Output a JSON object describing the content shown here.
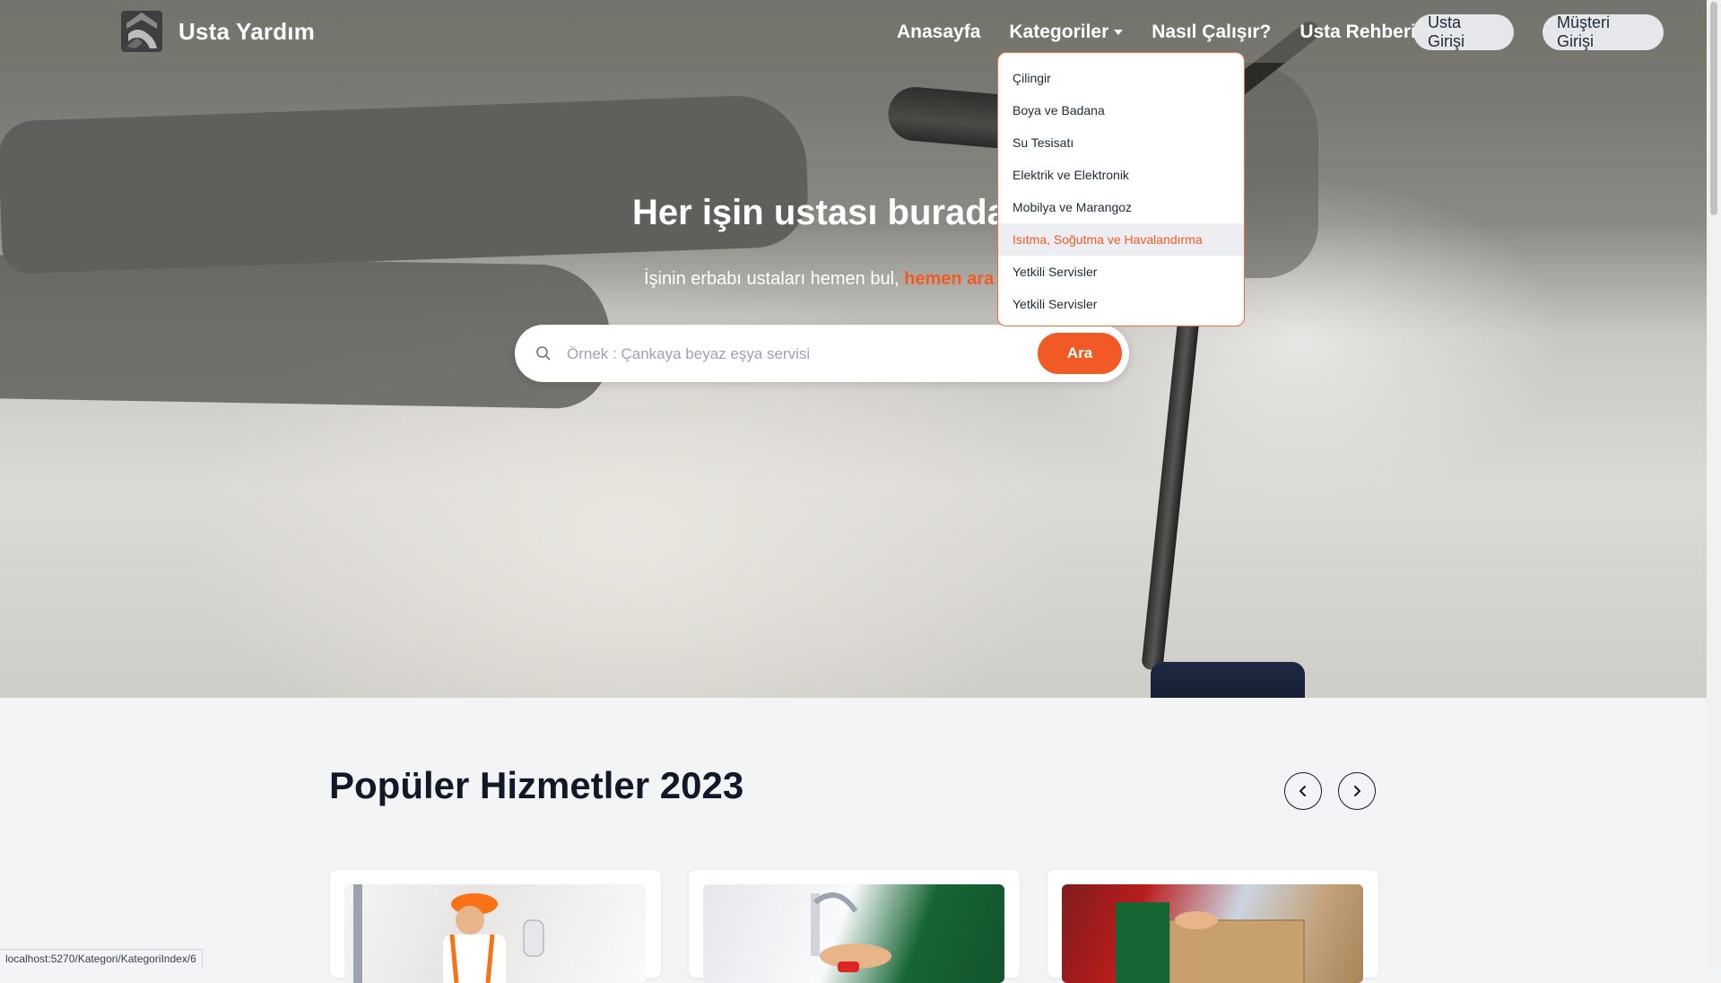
{
  "brand": {
    "name": "Usta Yardım"
  },
  "nav": {
    "home": "Anasayfa",
    "categories": "Kategoriler",
    "how_it_works": "Nasıl Çalışır?",
    "guide": "Usta Rehberi",
    "usta_login": "Usta Girişi",
    "customer_login": "Müşteri Girişi"
  },
  "dropdown": {
    "items": [
      "Çilingir",
      "Boya ve Badana",
      "Su Tesisatı",
      "Elektrik ve Elektronik",
      "Mobilya ve Marangoz",
      "Isıtma, Soğutma ve Havalandırma",
      "Yetkili Servisler",
      "Yetkili Servisler"
    ],
    "active_index": 5
  },
  "hero": {
    "title": "Her işin ustası burada",
    "subtitle": "İşinin erbabı ustaları hemen bul,",
    "subtitle_accent": "hemen ara"
  },
  "search": {
    "placeholder": "Örnek : Çankaya beyaz eşya servisi",
    "button": "Ara"
  },
  "popular": {
    "title": "Popüler Hizmetler 2023"
  },
  "status": {
    "url": "localhost:5270/Kategori/KategoriIndex/6"
  },
  "colors": {
    "accent": "#f15a24",
    "border_accent": "#f26b3a"
  }
}
